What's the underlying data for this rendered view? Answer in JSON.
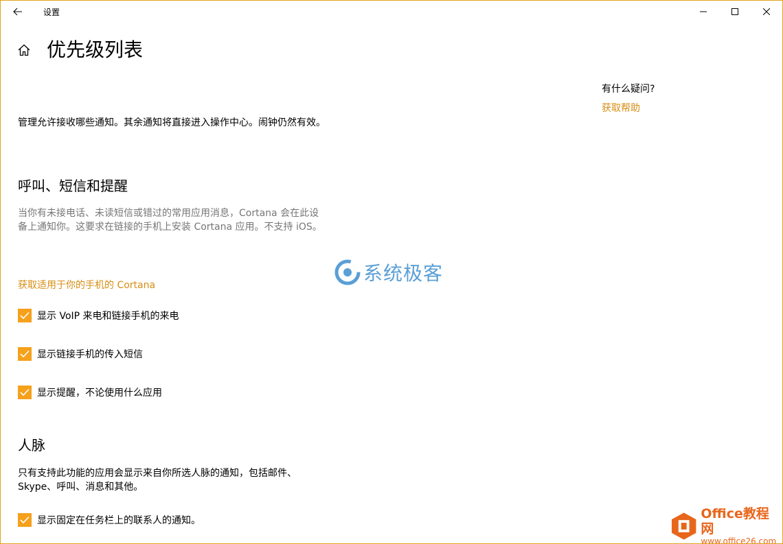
{
  "window": {
    "title": "设置",
    "accent_color": "#f5a11b",
    "link_color": "#d68d12",
    "border_color": "#e3a21a"
  },
  "header": {
    "page_title": "优先级列表"
  },
  "sidebar": {
    "question": "有什么疑问?",
    "help_link": "获取帮助"
  },
  "main": {
    "description": "管理允许接收哪些通知。其余通知将直接进入操作中心。闹钟仍然有效。",
    "section_calls": {
      "heading": "呼叫、短信和提醒",
      "description": "当你有未接电话、未读短信或错过的常用应用消息，Cortana 会在此设备上通知你。这要求在链接的手机上安装 Cortana 应用。不支持 iOS。",
      "link": "获取适用于你的手机的 Cortana",
      "checkboxes": [
        {
          "label": "显示 VoIP 来电和链接手机的来电",
          "checked": true
        },
        {
          "label": "显示链接手机的传入短信",
          "checked": true
        },
        {
          "label": "显示提醒，不论使用什么应用",
          "checked": true
        }
      ]
    },
    "section_people": {
      "heading": "人脉",
      "description": "只有支持此功能的应用会显示来自你所选人脉的通知，包括邮件、Skype、呼叫、消息和其他。",
      "checkboxes": [
        {
          "label": "显示固定在任务栏上的联系人的通知。",
          "checked": true
        }
      ]
    }
  },
  "watermark": {
    "text": "系统极客"
  },
  "office_logo": {
    "title": "Office教程网",
    "url": "www.office26.com"
  }
}
